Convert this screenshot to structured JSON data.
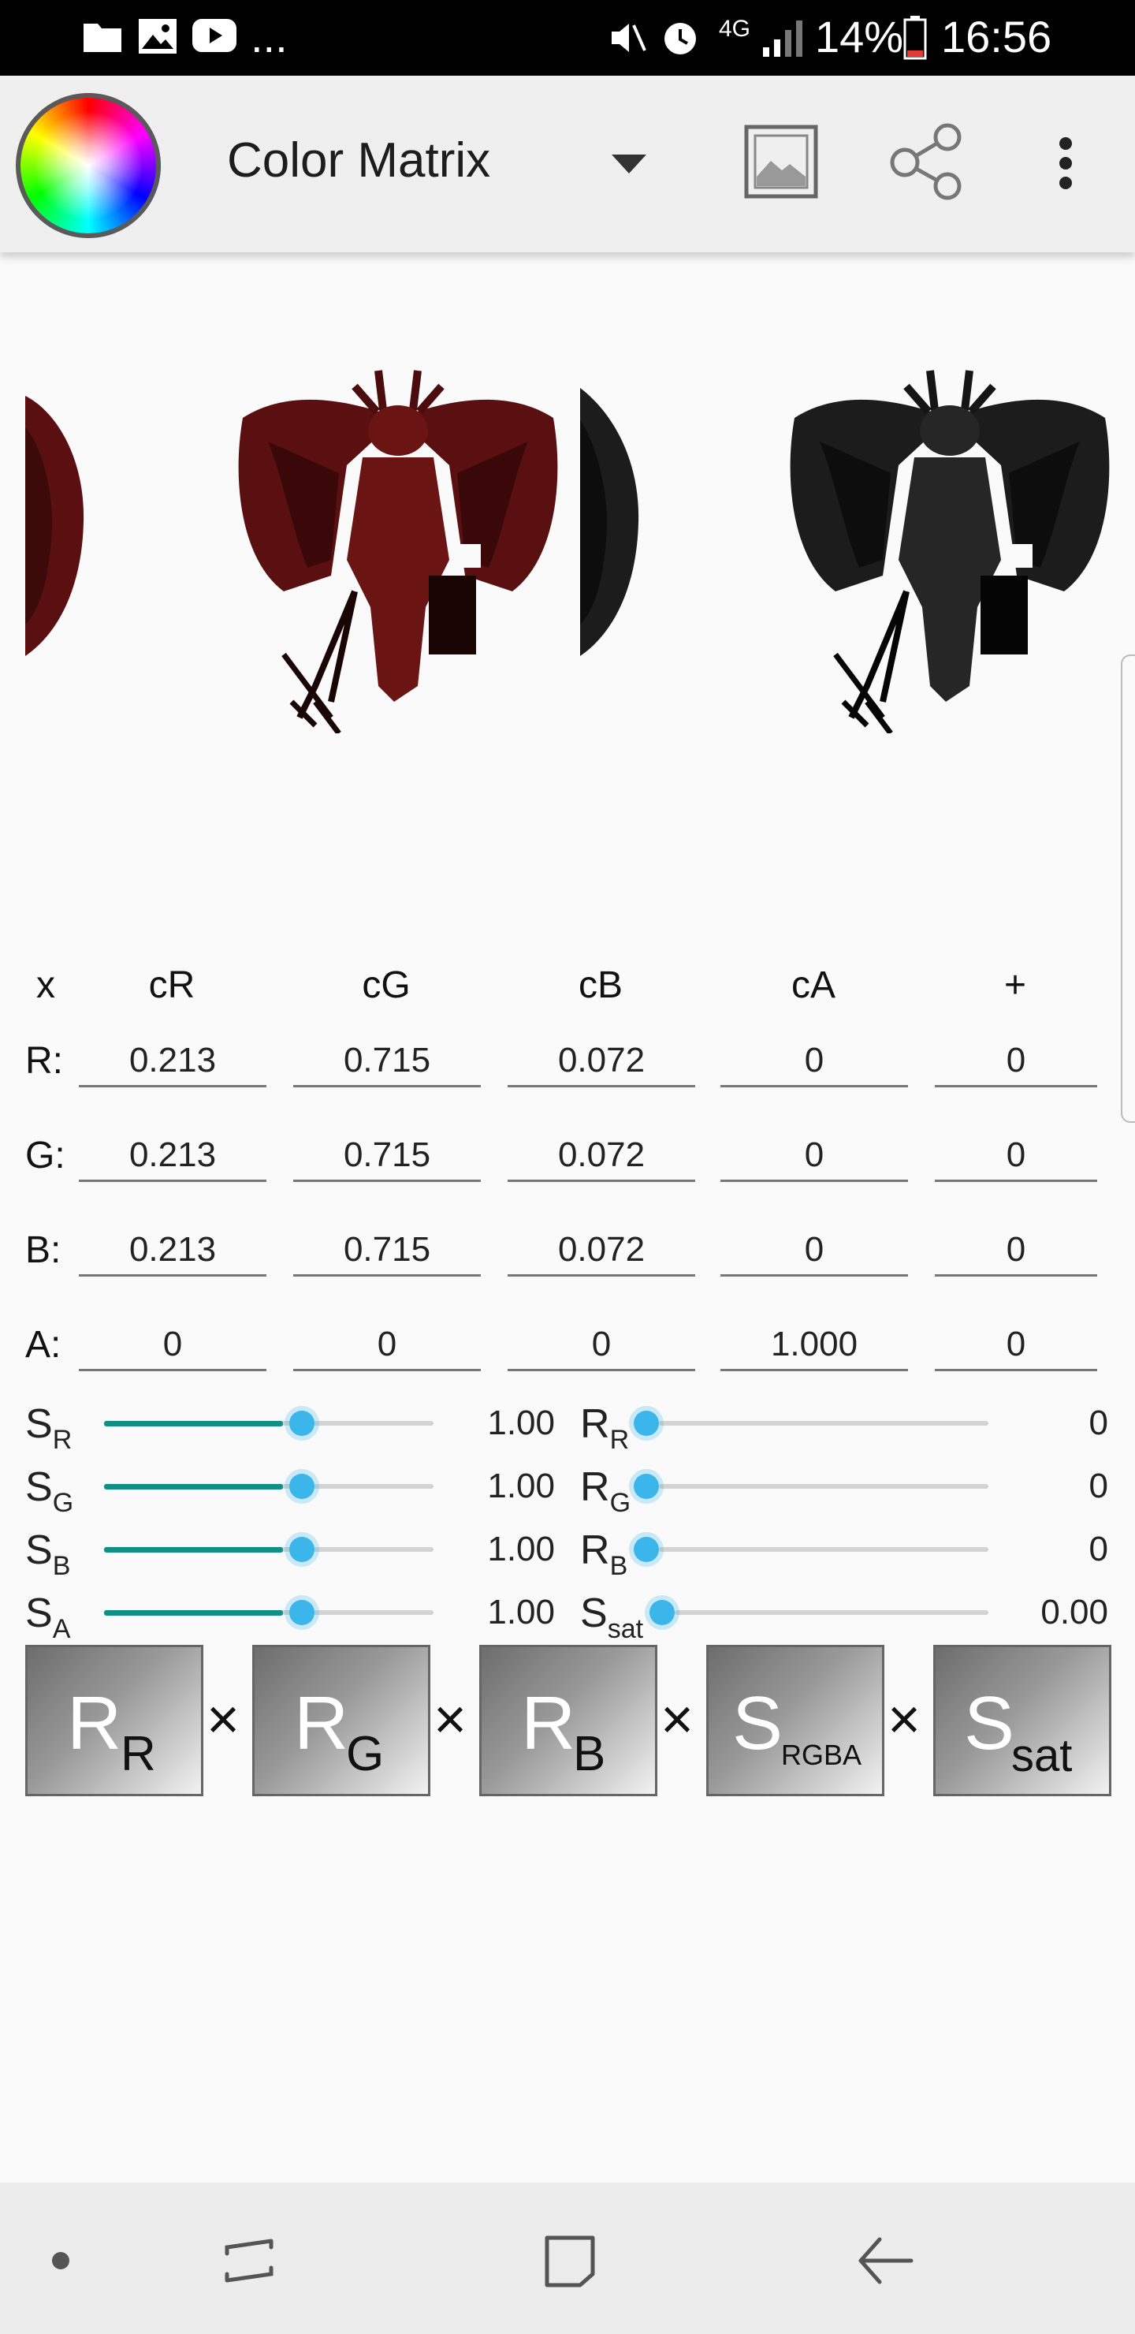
{
  "status_bar": {
    "more": "...",
    "network": "4G",
    "battery": "14%",
    "time": "16:56"
  },
  "app_bar": {
    "title": "Color Matrix",
    "icons": [
      "color-wheel-icon",
      "dropdown-arrow-icon",
      "image-icon",
      "share-icon",
      "more-vert-icon"
    ]
  },
  "matrix": {
    "corner": "x",
    "col_headers": [
      "cR",
      "cG",
      "cB",
      "cA",
      "+"
    ],
    "rows": [
      {
        "label": "R:",
        "cells": [
          "0.213",
          "0.715",
          "0.072",
          "0",
          "0"
        ]
      },
      {
        "label": "G:",
        "cells": [
          "0.213",
          "0.715",
          "0.072",
          "0",
          "0"
        ]
      },
      {
        "label": "B:",
        "cells": [
          "0.213",
          "0.715",
          "0.072",
          "0",
          "0"
        ]
      },
      {
        "label": "A:",
        "cells": [
          "0",
          "0",
          "0",
          "1.000",
          "0"
        ]
      }
    ]
  },
  "sliders": {
    "left": [
      {
        "main": "S",
        "sub": "R",
        "value": "1.00",
        "fraction": 0.6
      },
      {
        "main": "S",
        "sub": "G",
        "value": "1.00",
        "fraction": 0.6
      },
      {
        "main": "S",
        "sub": "B",
        "value": "1.00",
        "fraction": 0.6
      },
      {
        "main": "S",
        "sub": "A",
        "value": "1.00",
        "fraction": 0.6
      }
    ],
    "right": [
      {
        "main": "R",
        "sub": "R",
        "value": "0",
        "fraction": 0.0
      },
      {
        "main": "R",
        "sub": "G",
        "value": "0",
        "fraction": 0.0
      },
      {
        "main": "R",
        "sub": "B",
        "value": "0",
        "fraction": 0.0
      },
      {
        "main": "S",
        "sub": "sat",
        "value": "0.00",
        "fraction": 0.0
      }
    ]
  },
  "buttons": {
    "items": [
      {
        "main": "R",
        "sub": "R"
      },
      {
        "main": "R",
        "sub": "G"
      },
      {
        "main": "R",
        "sub": "B"
      },
      {
        "main": "S",
        "sub": "RGBA"
      },
      {
        "main": "S",
        "sub": "sat"
      }
    ],
    "separator": "×"
  },
  "nav_bar": {
    "icons": [
      "dot-icon",
      "recents-icon",
      "home-icon",
      "back-icon"
    ]
  },
  "colors": {
    "accent": "#118f86",
    "thumb": "#3cb6ea",
    "demon_original": "#5a1010",
    "demon_filtered": "#1a1a1a"
  }
}
